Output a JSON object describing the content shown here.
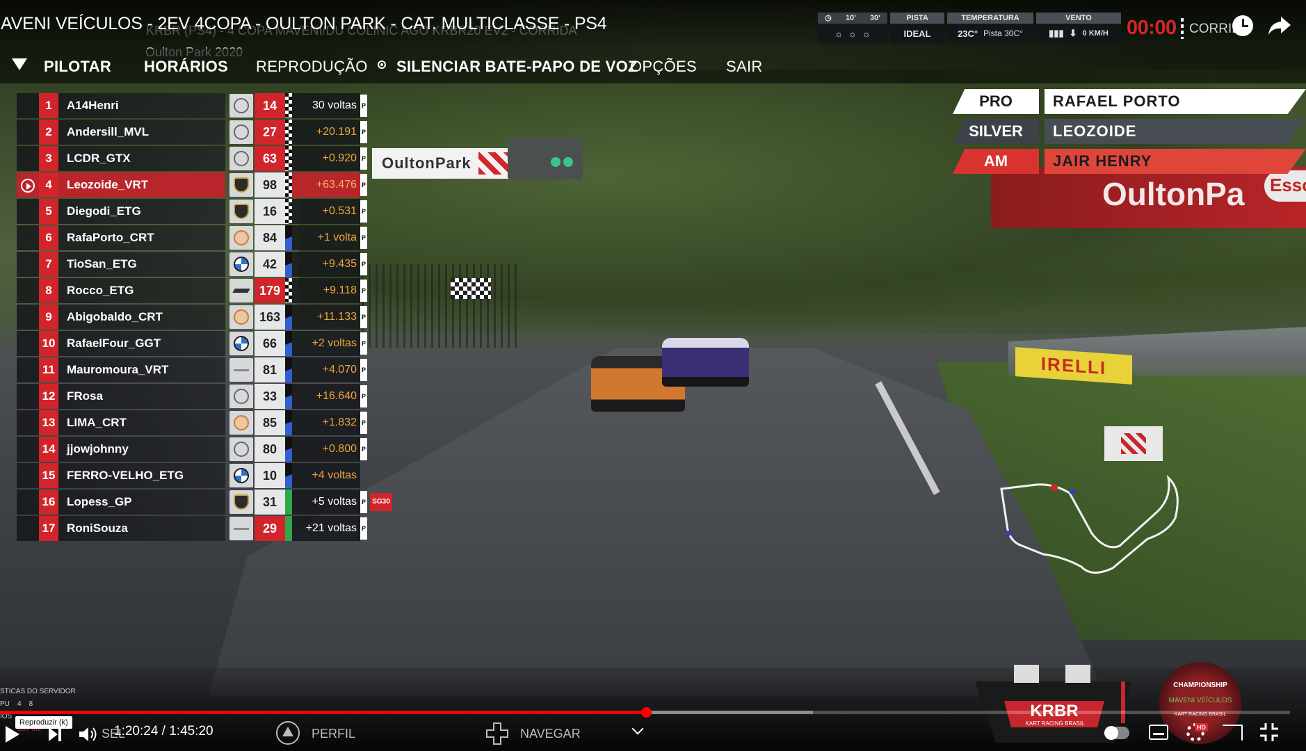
{
  "video": {
    "title": "AVENI VEÍCULOS - 2EV 4COPA - OULTON PARK - CAT. MULTICLASSE - PS4",
    "ghost_text": "KRBR (PS4) - 4 COPA MAVENI/DU COLINIC AGO KRBR20 EV2 - CORRIDA",
    "track_name": "Oulton Park 2020"
  },
  "race_hud": {
    "weather_times": [
      "10'",
      "30'"
    ],
    "pista_label": "PISTA",
    "pista_value": "IDEAL",
    "temp_label": "TEMPERATURA",
    "temp_air": "23C°",
    "temp_track": "Pista 30C°",
    "wind_label": "VENTO",
    "wind_dir": "⬇",
    "wind_speed": "0 KM/H",
    "clock": "00:00",
    "mode": "CORRIDA"
  },
  "menu": {
    "items": [
      "PILOTAR",
      "HORÁRIOS",
      "REPRODUÇÃO",
      "SILENCIAR BATE-PAPO DE VOZ",
      "OPÇÕES",
      "SAIR"
    ]
  },
  "leaderboard": [
    {
      "pos": "1",
      "name": "A14Henri",
      "brand": "mercedes-logo-icon",
      "num": "14",
      "num_red": true,
      "gap": "30 voltas",
      "gap_style": "white",
      "flag": "chequered",
      "p": "P"
    },
    {
      "pos": "2",
      "name": "Andersill_MVL",
      "brand": "mercedes-logo-icon",
      "num": "27",
      "num_red": true,
      "gap": "+20.191",
      "gap_style": "orange",
      "flag": "chequered",
      "p": "P"
    },
    {
      "pos": "3",
      "name": "LCDR_GTX",
      "brand": "bentley-logo-icon",
      "num": "63",
      "num_red": true,
      "gap": "+0.920",
      "gap_style": "orange",
      "flag": "chequered",
      "p": "P"
    },
    {
      "pos": "4",
      "name": "Leozoide_VRT",
      "brand": "lamborghini-logo-icon",
      "num": "98",
      "num_red": false,
      "gap": "+63.476",
      "gap_style": "orange",
      "flag": "chequered",
      "p": "P",
      "focus": true
    },
    {
      "pos": "5",
      "name": "Diegodi_ETG",
      "brand": "lamborghini-logo-icon",
      "num": "16",
      "num_red": false,
      "gap": "+0.531",
      "gap_style": "orange",
      "flag": "chequered",
      "p": "P"
    },
    {
      "pos": "6",
      "name": "RafaPorto_CRT",
      "brand": "ktm-logo-icon",
      "num": "84",
      "num_red": false,
      "gap": "+1 volta",
      "gap_style": "orange",
      "flag": "blue",
      "p": "P"
    },
    {
      "pos": "7",
      "name": "TioSan_ETG",
      "brand": "bmw-logo-icon",
      "num": "42",
      "num_red": false,
      "gap": "+9.435",
      "gap_style": "orange",
      "flag": "blue",
      "p": "P"
    },
    {
      "pos": "8",
      "name": "Rocco_ETG",
      "brand": "mclaren-logo-icon",
      "num": "179",
      "num_red": true,
      "gap": "+9.118",
      "gap_style": "orange",
      "flag": "chequered",
      "p": "P"
    },
    {
      "pos": "9",
      "name": "Abigobaldo_CRT",
      "brand": "ktm-logo-icon",
      "num": "163",
      "num_red": false,
      "gap": "+11.133",
      "gap_style": "orange",
      "flag": "blue",
      "p": "P"
    },
    {
      "pos": "10",
      "name": "RafaelFour_GGT",
      "brand": "bmw-logo-icon",
      "num": "66",
      "num_red": false,
      "gap": "+2 voltas",
      "gap_style": "orange",
      "flag": "blue",
      "p": "P"
    },
    {
      "pos": "11",
      "name": "Mauromoura_VRT",
      "brand": "flat-logo-icon",
      "num": "81",
      "num_red": false,
      "gap": "+4.070",
      "gap_style": "orange",
      "flag": "blue",
      "p": "P"
    },
    {
      "pos": "12",
      "name": "FRosa",
      "brand": "mercedes-logo-icon",
      "num": "33",
      "num_red": false,
      "gap": "+16.640",
      "gap_style": "orange",
      "flag": "blue",
      "p": "P"
    },
    {
      "pos": "13",
      "name": "LIMA_CRT",
      "brand": "ktm-logo-icon",
      "num": "85",
      "num_red": false,
      "gap": "+1.832",
      "gap_style": "orange",
      "flag": "blue",
      "p": "P"
    },
    {
      "pos": "14",
      "name": "jjowjohnny",
      "brand": "mercedes-logo-icon",
      "num": "80",
      "num_red": false,
      "gap": "+0.800",
      "gap_style": "orange",
      "flag": "blue",
      "p": "P"
    },
    {
      "pos": "15",
      "name": "FERRO-VELHO_ETG",
      "brand": "bmw-logo-icon",
      "num": "10",
      "num_red": false,
      "gap": "+4 voltas",
      "gap_style": "orange",
      "flag": "blue",
      "p": ""
    },
    {
      "pos": "16",
      "name": "Lopess_GP",
      "brand": "lamborghini-logo-icon",
      "num": "31",
      "num_red": false,
      "gap": "+5 voltas",
      "gap_style": "white",
      "flag": "green",
      "p": "P",
      "badge": "SG30"
    },
    {
      "pos": "17",
      "name": "RoniSouza",
      "brand": "flat-logo-icon",
      "num": "29",
      "num_red": true,
      "gap": "+21 voltas",
      "gap_style": "white",
      "flag": "green",
      "p": "P"
    }
  ],
  "classes": [
    {
      "tag": "PRO",
      "name": "RAFAEL PORTO",
      "style": "pro"
    },
    {
      "tag": "SILVER",
      "name": "LEOZOIDE",
      "style": "silver"
    },
    {
      "tag": "AM",
      "name": "JAIR HENRY",
      "style": "am"
    }
  ],
  "scene": {
    "sign_oulton": "OultonPark",
    "banner_oulton": "OultonPa",
    "esso": "Esso",
    "pirelli": "IRELLI"
  },
  "server_stats": {
    "title": "STICAS DO SERVIDOR",
    "cpu": "PU    4    8",
    "ios": "IOS",
    "lag": "207 ms"
  },
  "player": {
    "tooltip": "Reproduzir (k)",
    "time": "1:20:24 / 1:45:20",
    "progress": 0.501,
    "buffered": 0.63,
    "hd": "HD"
  },
  "console_hints": {
    "select": "SEL",
    "profile": "PERFIL",
    "navigate": "NAVEGAR"
  },
  "logos": {
    "krbr": "KRBR",
    "krbr_sub": "KART RACING BRASIL",
    "championship": "CHAMPIONSHIP",
    "maveni": "MAVENI VEÍCULOS",
    "champ_sub": "KART RACING BRASIL"
  }
}
